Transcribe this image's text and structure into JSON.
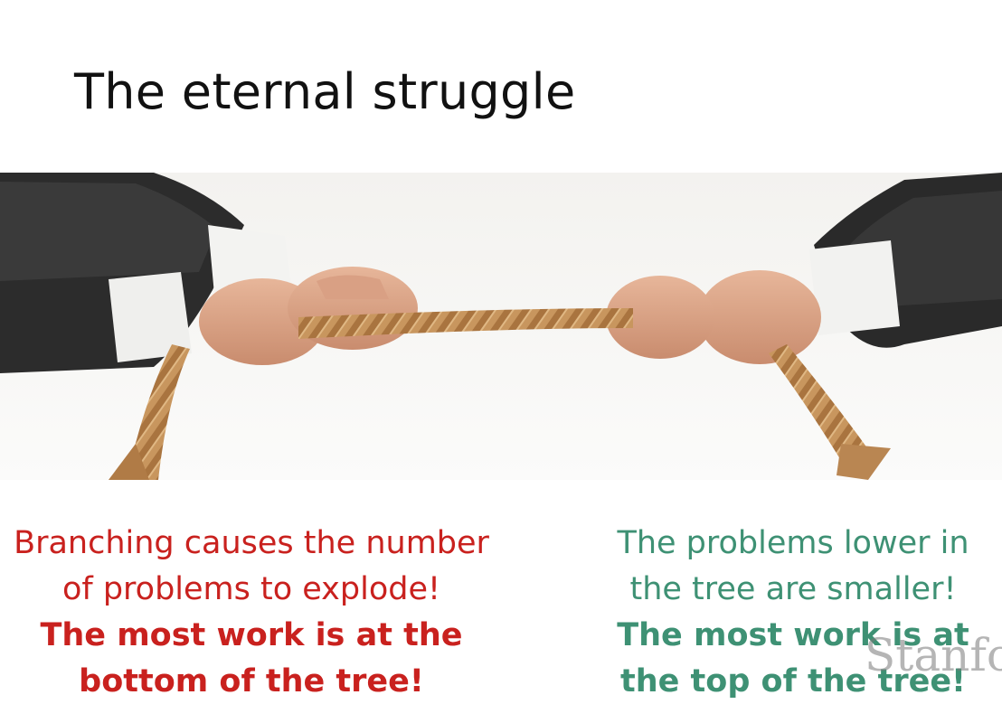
{
  "slide": {
    "title": "The eternal struggle",
    "left": {
      "lines": [
        "Branching causes the number",
        "of problems to explode!"
      ],
      "bold_lines": [
        "The most work is at the",
        "bottom of the tree!"
      ],
      "color": "#c9211e"
    },
    "right": {
      "lines": [
        "The problems lower in",
        "the tree are smaller!"
      ],
      "bold_lines": [
        "The most work is at",
        "the top of the tree!"
      ],
      "color": "#3e9174"
    },
    "watermark": "Stanford"
  },
  "image": {
    "subject": "tug-of-war-rope-hands",
    "icon": "tug-of-war-photo"
  }
}
